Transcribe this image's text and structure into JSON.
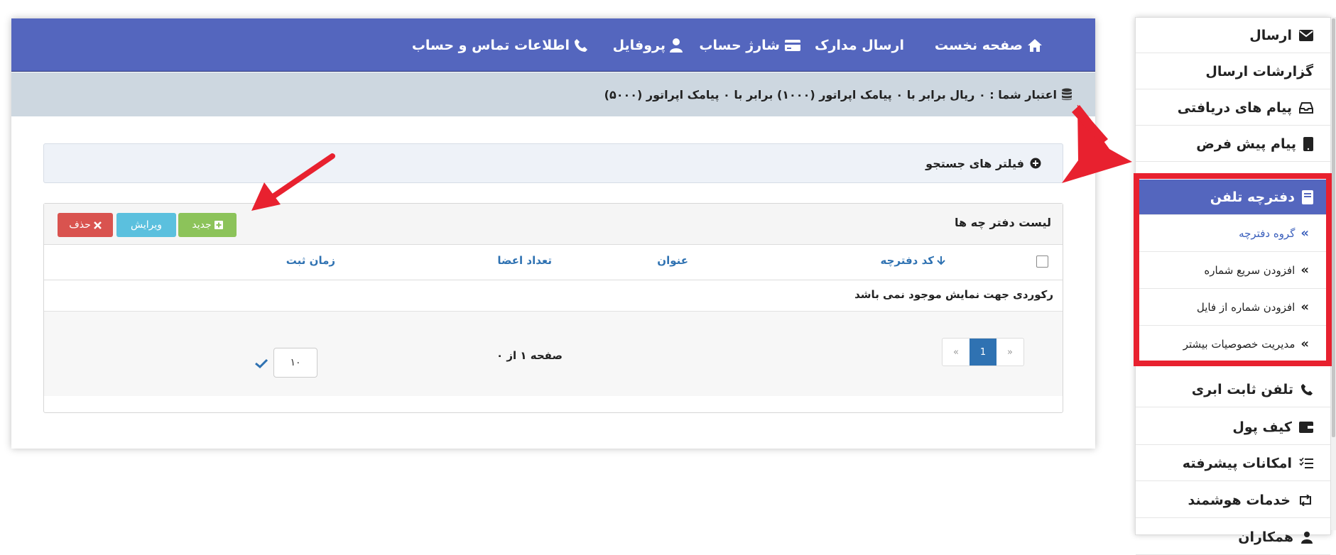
{
  "topnav": {
    "home": "صفحه نخست",
    "documents": "ارسال مدارک",
    "charge": "شارژ حساب",
    "profile": "پروفایل",
    "contact": "اطلاعات تماس و حساب"
  },
  "credit": {
    "text": "اعتبار شما : ۰ ریال برابر با ۰ پیامک اپراتور (۱۰۰۰) برابر با ۰ پیامک اپراتور (۵۰۰۰)"
  },
  "filter": {
    "label": "فیلتر های جستجو"
  },
  "list": {
    "title": "لیست دفتر چه ها",
    "buttons": {
      "new": "جدید",
      "edit": "ویرایش",
      "delete": "حذف"
    },
    "columns": {
      "code": "کد دفترچه",
      "title": "عنوان",
      "members": "تعداد اعضا",
      "created": "زمان ثبت"
    },
    "empty_message": "رکوردی جهت نمایش موجود نمی باشد",
    "pager": {
      "prev": "«",
      "current": "1",
      "next": "»"
    },
    "page_info": "صفحه ۱ از ۰",
    "per_page": "۱۰"
  },
  "sidebar": {
    "items": [
      {
        "label": "ارسال",
        "icon": "envelope-icon"
      },
      {
        "label": "گزارشات ارسال",
        "icon": ""
      },
      {
        "label": "پیام های دریافتی",
        "icon": "inbox-icon"
      },
      {
        "label": "پیام پیش فرض",
        "icon": "tablet-icon"
      },
      {
        "label": "دفترچه تلفن",
        "icon": "book-icon"
      },
      {
        "label": "تلفن ثابت ابری",
        "icon": "phone-icon"
      },
      {
        "label": "کیف پول",
        "icon": "wallet-icon"
      },
      {
        "label": "امکانات پیشرفته",
        "icon": "tasks-icon"
      },
      {
        "label": "خدمات هوشمند",
        "icon": "retweet-icon"
      },
      {
        "label": "همکاران",
        "icon": "user-group-icon"
      }
    ],
    "sub_items": [
      {
        "label": "گروه دفترچه"
      },
      {
        "label": "افزودن سریع شماره"
      },
      {
        "label": "افزودن شماره از فایل"
      },
      {
        "label": "مدیریت خصوصیات بیشتر"
      }
    ]
  },
  "colors": {
    "nav_bg": "#5466be",
    "credit_bg": "#cdd7e0",
    "accent_red": "#e8212f",
    "link_blue": "#2f72b2"
  }
}
